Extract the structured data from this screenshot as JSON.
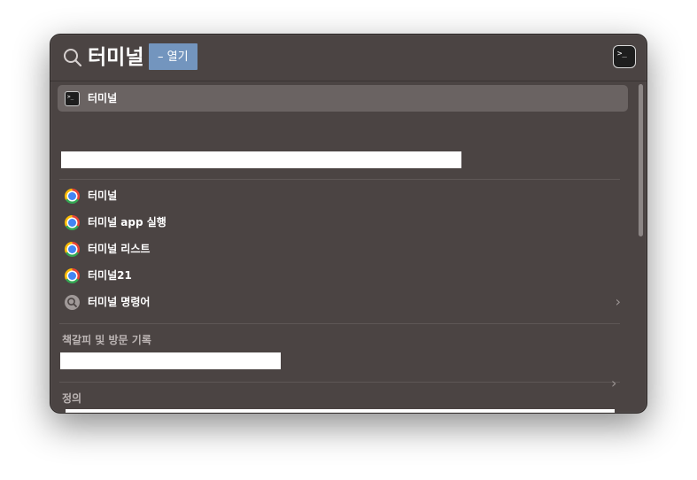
{
  "search": {
    "query": "터미널",
    "suggestion": "– 열기",
    "top_app_icon": "terminal-icon"
  },
  "top_hit": {
    "label": "터미널",
    "icon": "terminal-icon"
  },
  "web_results": [
    {
      "label": "터미널",
      "icon": "chrome-icon"
    },
    {
      "label": "터미널 app 실행",
      "icon": "chrome-icon"
    },
    {
      "label": "터미널 리스트",
      "icon": "chrome-icon"
    },
    {
      "label": "터미널21",
      "icon": "chrome-icon"
    },
    {
      "label": "터미널 명령어",
      "icon": "search-icon",
      "chevron": "›"
    }
  ],
  "sections": {
    "bookmarks_header": "책갈피 및 방문 기록",
    "definition_header": "정의",
    "definition_chevron": "›"
  },
  "icons": {
    "terminal_glyph": ">_"
  },
  "colors": {
    "window_bg": "#4b4443",
    "selected_row": "#6a6362",
    "suggestion_bg": "#7395be"
  }
}
